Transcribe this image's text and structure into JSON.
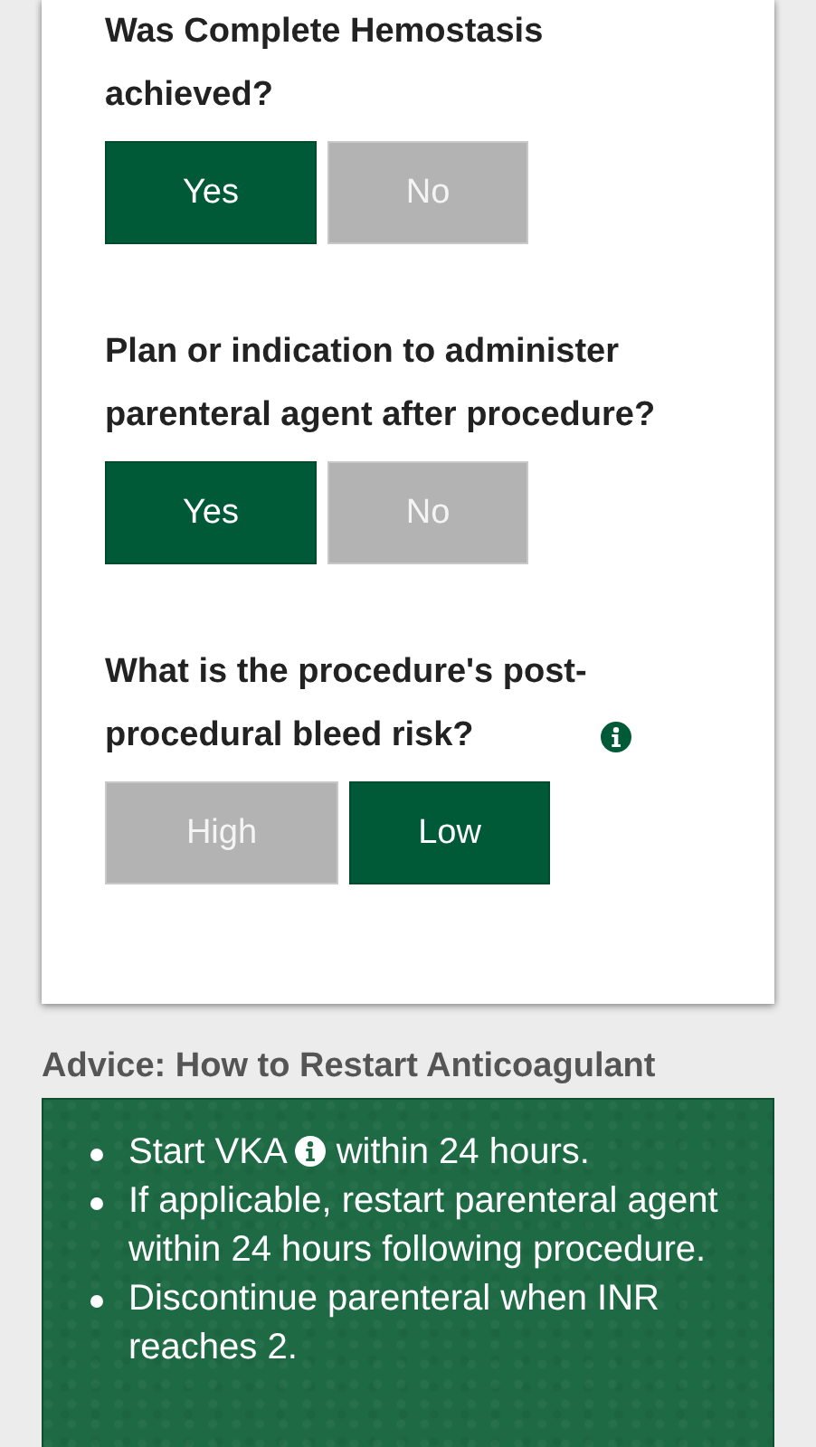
{
  "questions": [
    {
      "text": "Was Complete Hemostasis achieved?",
      "info": false,
      "options": [
        {
          "label": "Yes",
          "selected": true
        },
        {
          "label": "No",
          "selected": false
        }
      ]
    },
    {
      "text": "Plan or indication to administer parenteral agent after procedure?",
      "info": false,
      "options": [
        {
          "label": "Yes",
          "selected": true
        },
        {
          "label": "No",
          "selected": false
        }
      ]
    },
    {
      "text": "What is the procedure's post-procedural bleed risk?",
      "info": true,
      "options": [
        {
          "label": "High",
          "selected": false
        },
        {
          "label": "Low",
          "selected": true
        }
      ]
    }
  ],
  "advice": {
    "title": "Advice: How to Restart Anticoagulant",
    "items": [
      {
        "parts": [
          "Start VKA",
          "within 24 hours."
        ]
      },
      {
        "parts": [
          "If applicable, restart parenteral agent within 24 hours following procedure."
        ]
      },
      {
        "parts": [
          "Discontinue parenteral when INR reaches 2."
        ]
      }
    ]
  }
}
